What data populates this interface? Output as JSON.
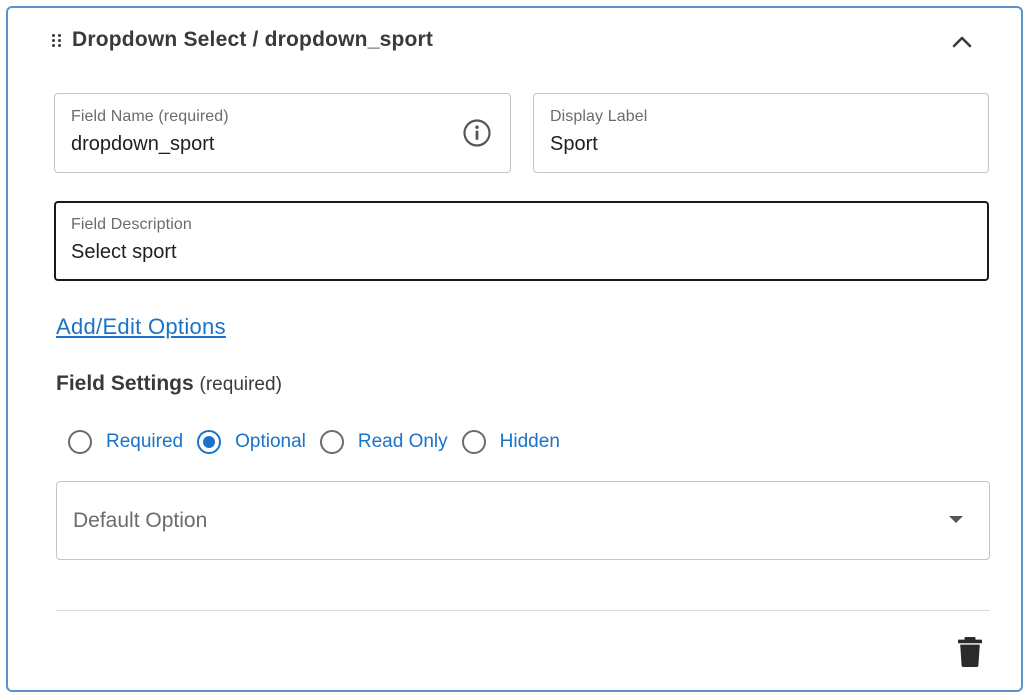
{
  "header": {
    "title": "Dropdown Select / dropdown_sport",
    "drag_icon": "drag-handle-icon",
    "collapse_icon": "chevron-up-icon"
  },
  "fields": {
    "field_name": {
      "label": "Field Name (required)",
      "value": "dropdown_sport",
      "icon": "info-icon"
    },
    "display_label": {
      "label": "Display Label",
      "value": "Sport"
    },
    "field_description": {
      "label": "Field Description",
      "value": "Select sport"
    }
  },
  "options_link": "Add/Edit Options",
  "settings": {
    "title": "Field Settings",
    "required_note": "(required)",
    "options": [
      {
        "label": "Required",
        "checked": false
      },
      {
        "label": "Optional",
        "checked": true
      },
      {
        "label": "Read Only",
        "checked": false
      },
      {
        "label": "Hidden",
        "checked": false
      }
    ],
    "selected": "Optional"
  },
  "default_option": {
    "label": "Default Option",
    "value": ""
  },
  "footer": {
    "delete_icon": "trash-icon"
  },
  "colors": {
    "accent": "#1a73c8",
    "card_border": "#5b93c9",
    "text": "#3a3a3a",
    "muted": "#6b6b6b"
  }
}
